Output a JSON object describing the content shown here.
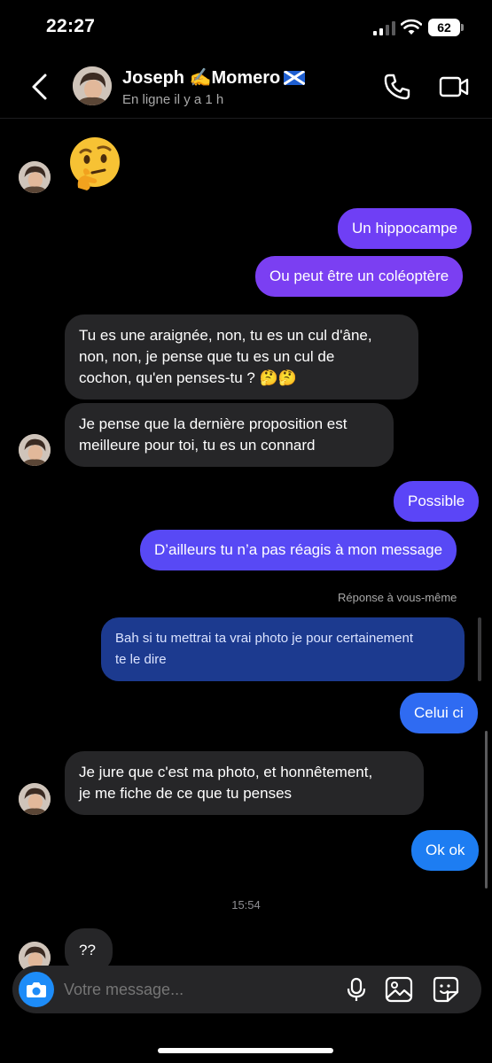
{
  "status_bar": {
    "time": "22:27",
    "battery": "62"
  },
  "header": {
    "contact_name": "Joseph ✍️Momero",
    "status": "En ligne il y a 1 h"
  },
  "messages": [
    {
      "side": "received",
      "text": "🤔",
      "kind": "emoji"
    },
    {
      "side": "sent",
      "text": "Un hippocampe",
      "color": "#6f3ff5"
    },
    {
      "side": "sent",
      "text": "Ou peut être un coléoptère",
      "color": "#7b3ff2"
    },
    {
      "side": "received",
      "lines": [
        "Tu es une araignée, non, tu es un cul d'âne,",
        "non, non, je pense que tu es un cul de",
        "cochon, qu'en penses-tu ? 🤔🤔"
      ]
    },
    {
      "side": "received",
      "lines": [
        "Je pense que la dernière proposition est",
        "meilleure pour toi, tu es un connard"
      ]
    },
    {
      "side": "sent",
      "text": "Possible",
      "color": "#5b45f7"
    },
    {
      "side": "sent",
      "text": "D’ailleurs tu n’a pas réagis à mon message",
      "color": "#5849f5"
    },
    {
      "side": "sent",
      "text": "Celui ci",
      "color": "#2f6bf2",
      "reply_label": "Réponse à vous-même",
      "quoted_lines": [
        "Bah si tu mettrai ta vrai photo je pour certainement",
        "te le dire"
      ]
    },
    {
      "side": "received",
      "lines": [
        "Je jure que c'est ma photo, et honnêtement,",
        "je me fiche de ce que tu penses"
      ]
    },
    {
      "side": "sent",
      "text": "Ok ok",
      "color": "#1d7df2"
    },
    {
      "side": "received",
      "text": "??"
    }
  ],
  "timestamp": "15:54",
  "composer": {
    "placeholder": "Votre message..."
  },
  "colors": {
    "background": "#000000",
    "received_bubble": "#262628",
    "camera_button": "#1d8cf8"
  }
}
